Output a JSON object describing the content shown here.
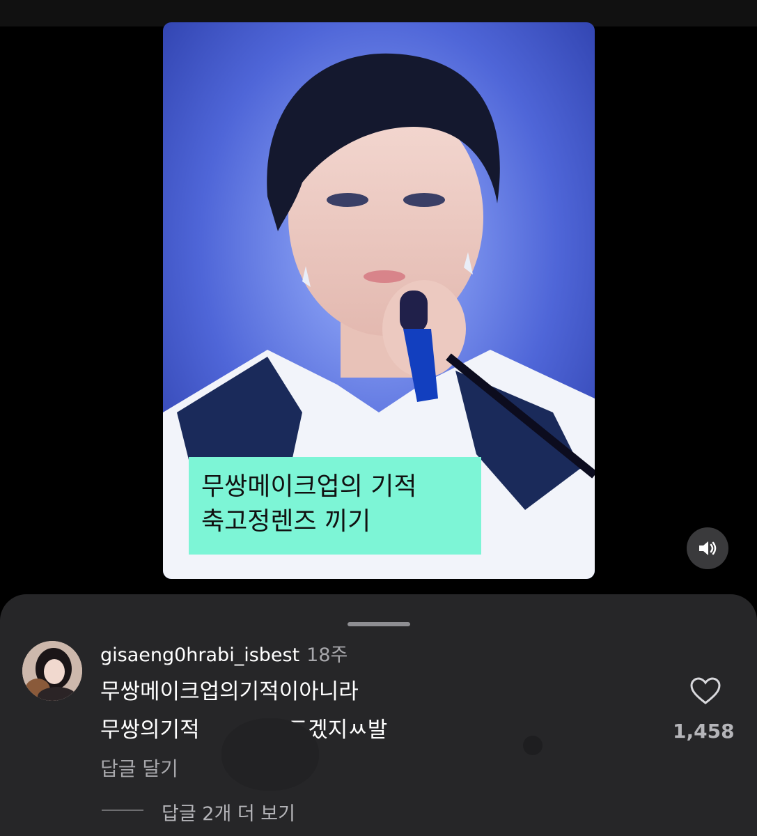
{
  "video": {
    "caption_line1": "무쌍메이크업의 기적",
    "caption_line2": "축고정렌즈 끼기",
    "caption_bg": "#7df5d6"
  },
  "controls": {
    "sound_icon": "speaker-volume-icon"
  },
  "comment": {
    "username": "gisaeng0hrabi_isbest",
    "time": "18주",
    "line1": "무쌍메이크업의기적이아니라",
    "line2": "무쌍의기적          오드겠지ㅆ발",
    "reply_label": "답글 달기",
    "like_icon": "heart-icon",
    "like_count": "1,458",
    "more_replies": "답글 2개 더 보기"
  }
}
